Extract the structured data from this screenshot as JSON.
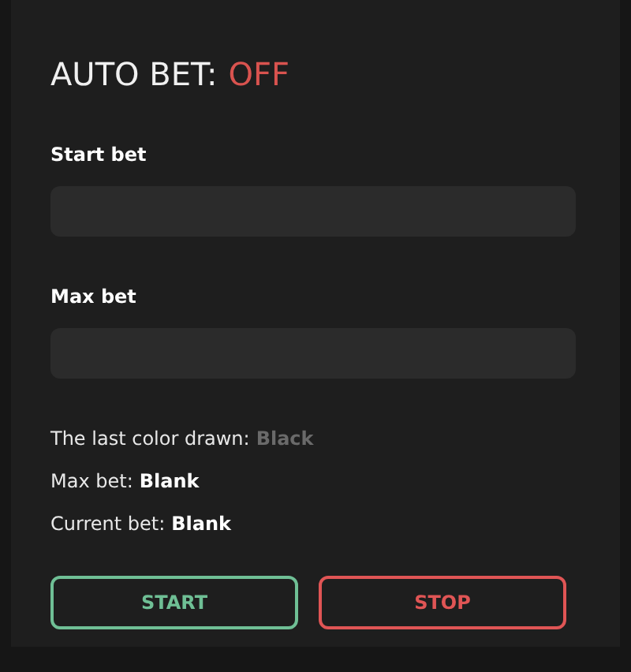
{
  "header": {
    "label": "AUTO BET:",
    "status": "OFF",
    "on": false
  },
  "fields": [
    {
      "label": "Start bet"
    },
    {
      "label": "Max bet"
    }
  ],
  "stats": [
    {
      "label": "The last color drawn:",
      "value": "Black",
      "color": "#6a6a6a"
    },
    {
      "label": "Max bet:",
      "value": "Blank",
      "color": "#ffffff"
    },
    {
      "label": "Current bet:",
      "value": "Blank",
      "color": "#ffffff"
    }
  ],
  "buttons": [
    {
      "label": "START",
      "kind": "start"
    },
    {
      "label": "STOP",
      "kind": "stop"
    }
  ]
}
